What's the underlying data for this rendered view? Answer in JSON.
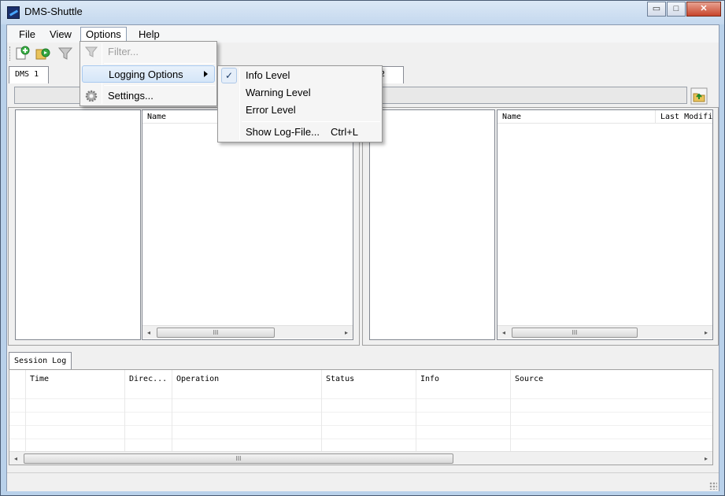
{
  "window": {
    "title": "DMS-Shuttle",
    "minimize": "▭",
    "maximize": "□",
    "close": "✕"
  },
  "menubar": {
    "file": "File",
    "view": "View",
    "options": "Options",
    "help": "Help"
  },
  "tabs": {
    "left": "DMS 1",
    "right": "2"
  },
  "left_panel": {
    "col_name": "Name"
  },
  "right_panel": {
    "col_name": "Name",
    "col_modified": "Last Modifi"
  },
  "scroll": {
    "left": "◂",
    "right": "▸",
    "thumb": "III"
  },
  "session_log": {
    "tab": "Session Log",
    "columns": [
      "Time",
      "Direc...",
      "Operation",
      "Status",
      "Info",
      "Source"
    ]
  },
  "options_menu": {
    "filter": "Filter...",
    "logging": "Logging Options",
    "settings": "Settings..."
  },
  "logging_menu": {
    "info": "Info Level",
    "info_checked": "✓",
    "warning": "Warning Level",
    "error": "Error Level",
    "show_log": "Show Log-File...",
    "show_log_shortcut": "Ctrl+L"
  }
}
